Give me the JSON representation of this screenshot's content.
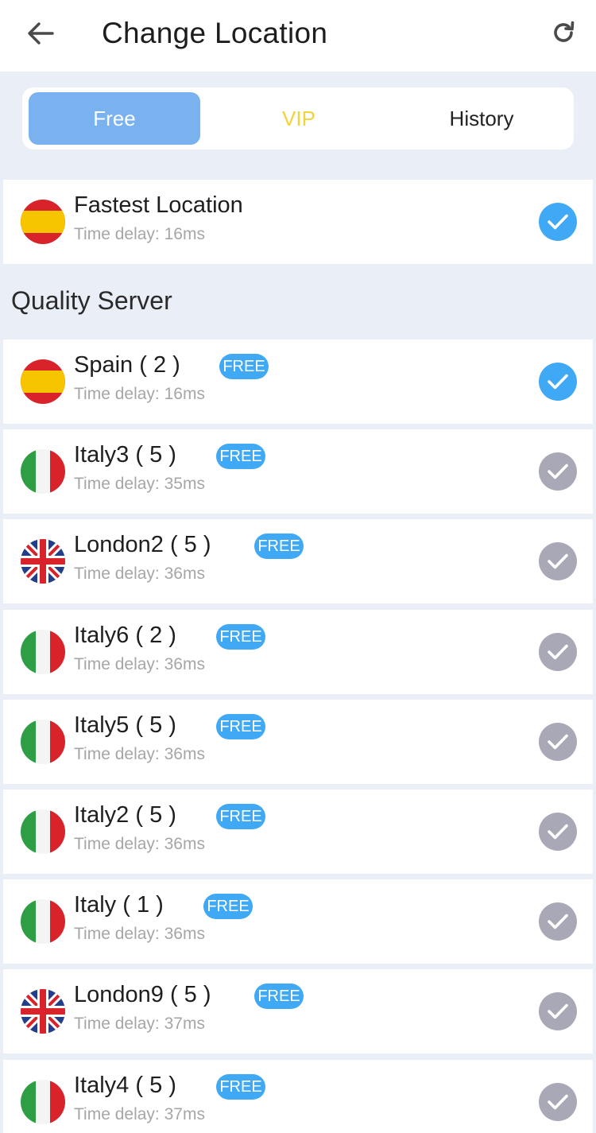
{
  "header": {
    "title": "Change Location",
    "back_icon": "arrow-left-icon",
    "refresh_icon": "refresh-icon"
  },
  "tabs": [
    {
      "label": "Free",
      "active": true
    },
    {
      "label": "VIP",
      "active": false
    },
    {
      "label": "History",
      "active": false
    }
  ],
  "fastest": {
    "name": "Fastest Location",
    "delay": "Time delay: 16ms",
    "flag": "spain",
    "selected": true
  },
  "section_title": "Quality Server",
  "servers": [
    {
      "name": "Spain ( 2 )",
      "badge": "FREE",
      "delay": "Time delay: 16ms",
      "flag": "spain",
      "selected": true
    },
    {
      "name": "Italy3 ( 5 )",
      "badge": "FREE",
      "delay": "Time delay: 35ms",
      "flag": "italy",
      "selected": false
    },
    {
      "name": "London2 ( 5 )",
      "badge": "FREE",
      "delay": "Time delay: 36ms",
      "flag": "uk",
      "selected": false
    },
    {
      "name": "Italy6 ( 2 )",
      "badge": "FREE",
      "delay": "Time delay: 36ms",
      "flag": "italy",
      "selected": false
    },
    {
      "name": "Italy5 ( 5 )",
      "badge": "FREE",
      "delay": "Time delay: 36ms",
      "flag": "italy",
      "selected": false
    },
    {
      "name": "Italy2 ( 5 )",
      "badge": "FREE",
      "delay": "Time delay: 36ms",
      "flag": "italy",
      "selected": false
    },
    {
      "name": "Italy ( 1 )",
      "badge": "FREE",
      "delay": "Time delay: 36ms",
      "flag": "italy",
      "selected": false
    },
    {
      "name": "London9 ( 5 )",
      "badge": "FREE",
      "delay": "Time delay: 37ms",
      "flag": "uk",
      "selected": false
    },
    {
      "name": "Italy4 ( 5 )",
      "badge": "FREE",
      "delay": "Time delay: 37ms",
      "flag": "italy",
      "selected": false
    }
  ],
  "colors": {
    "accent": "#3fa9f5",
    "tab_active": "#79b2ef",
    "vip": "#f3d33b",
    "check_off": "#a9a8b6",
    "background": "#eaeef7"
  }
}
